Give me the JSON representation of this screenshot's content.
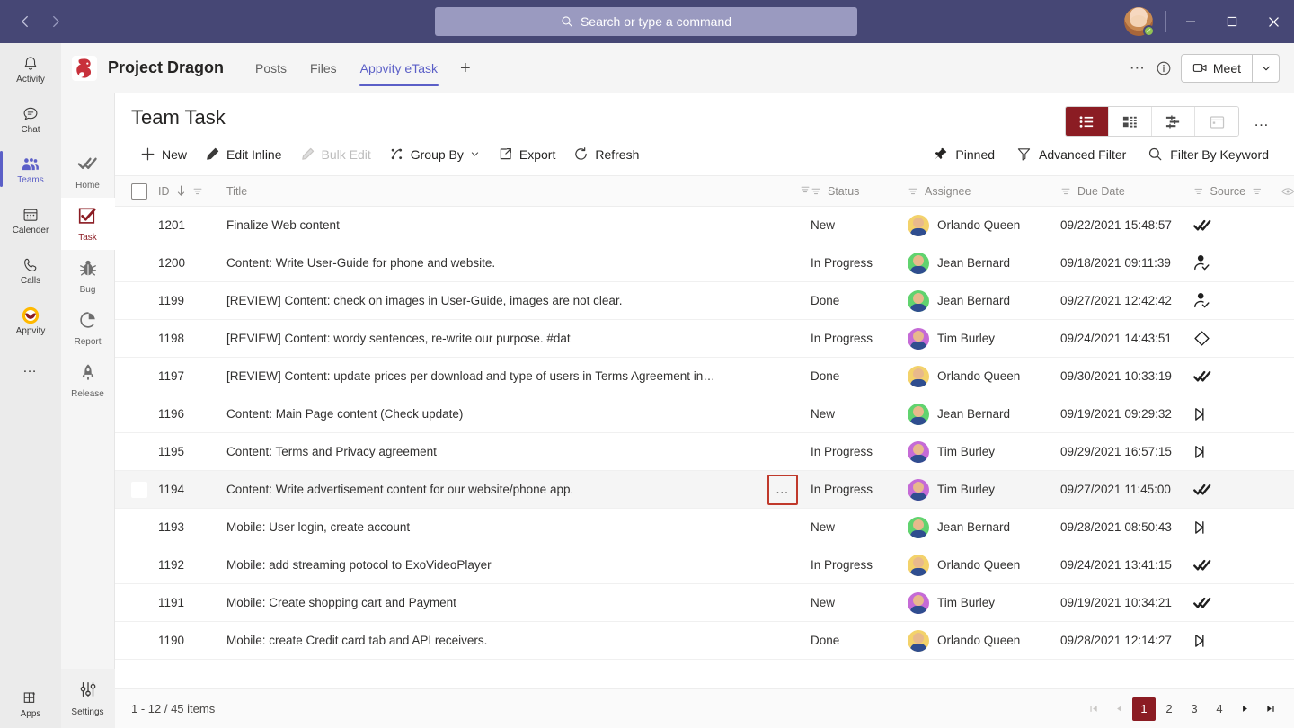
{
  "titlebar": {
    "back_icon": "chevron-left-icon",
    "forward_icon": "chevron-right-icon",
    "search_placeholder": "Search or type a command",
    "search_icon": "search-icon",
    "presence_status": "available",
    "minimize_label": "–",
    "maximize_label": "❐",
    "close_label": "✕"
  },
  "rail": {
    "items": [
      {
        "label": "Activity",
        "icon": "bell-icon",
        "active": false
      },
      {
        "label": "Chat",
        "icon": "chat-icon",
        "active": false
      },
      {
        "label": "Teams",
        "icon": "teams-icon",
        "active": true
      },
      {
        "label": "Calender",
        "icon": "calendar-icon",
        "active": false
      },
      {
        "label": "Calls",
        "icon": "phone-icon",
        "active": false
      },
      {
        "label": "Appvity",
        "icon": "appvity-icon",
        "active": false
      }
    ],
    "more_label": "…",
    "apps_label": "Apps",
    "apps_icon": "apps-icon"
  },
  "appnav": {
    "items": [
      {
        "label": "Home",
        "icon": "double-check-icon",
        "active": false
      },
      {
        "label": "Task",
        "icon": "task-check-icon",
        "active": true
      },
      {
        "label": "Bug",
        "icon": "bug-icon",
        "active": false
      },
      {
        "label": "Report",
        "icon": "pie-chart-icon",
        "active": false
      },
      {
        "label": "Release",
        "icon": "rocket-icon",
        "active": false
      }
    ],
    "settings_label": "Settings",
    "settings_icon": "sliders-icon"
  },
  "channel": {
    "team_name": "Project Dragon",
    "team_logo_icon": "dragon-logo-icon",
    "tabs": [
      {
        "label": "Posts",
        "active": false
      },
      {
        "label": "Files",
        "active": false
      },
      {
        "label": "Appvity eTask",
        "active": true
      }
    ],
    "add_tab_label": "+",
    "more_icon": "ellipsis-icon",
    "info_icon": "info-circle-icon",
    "meet_label": "Meet",
    "meet_icon": "camera-icon",
    "meet_caret_icon": "chevron-down-icon"
  },
  "page": {
    "title": "Team Task",
    "view_buttons": [
      {
        "icon": "list-view-icon",
        "active": true,
        "disabled": false
      },
      {
        "icon": "board-view-icon",
        "active": false,
        "disabled": false
      },
      {
        "icon": "gantt-view-icon",
        "active": false,
        "disabled": false
      },
      {
        "icon": "calendar-view-icon",
        "active": false,
        "disabled": true
      }
    ],
    "view_more_label": "…"
  },
  "toolbar": {
    "left": [
      {
        "label": "New",
        "icon": "plus-icon",
        "disabled": false
      },
      {
        "label": "Edit Inline",
        "icon": "pencil-icon",
        "disabled": false
      },
      {
        "label": "Bulk Edit",
        "icon": "pencil-icon",
        "disabled": true
      },
      {
        "label": "Group By",
        "icon": "group-by-icon",
        "disabled": false,
        "caret": true
      },
      {
        "label": "Export",
        "icon": "export-icon",
        "disabled": false
      },
      {
        "label": "Refresh",
        "icon": "refresh-icon",
        "disabled": false
      }
    ],
    "right": [
      {
        "label": "Pinned",
        "icon": "pin-icon"
      },
      {
        "label": "Advanced Filter",
        "icon": "funnel-icon"
      },
      {
        "label": "Filter By Keyword",
        "icon": "search-icon"
      }
    ]
  },
  "table": {
    "columns": [
      {
        "key": "checkbox",
        "label": ""
      },
      {
        "key": "id",
        "label": "ID",
        "sort_icon": "sort-down-icon",
        "filter_icon": "filter-icon"
      },
      {
        "key": "title",
        "label": "Title",
        "filter_icon": "filter-icon"
      },
      {
        "key": "status",
        "label": "Status",
        "filter_icon": "filter-icon"
      },
      {
        "key": "assignee",
        "label": "Assignee",
        "filter_icon": "filter-icon"
      },
      {
        "key": "due_date",
        "label": "Due Date",
        "filter_icon": "filter-icon"
      },
      {
        "key": "source",
        "label": "Source",
        "filter_icon": "filter-icon"
      },
      {
        "key": "visibility",
        "label": "",
        "icon": "eye-icon"
      }
    ],
    "rows": [
      {
        "id": "1201",
        "title": "Finalize Web content",
        "status": "New",
        "assignee": "Orlando Queen",
        "avatar_color": "#f3d26b",
        "due_date": "09/22/2021 15:48:57",
        "source_icon": "double-check-icon",
        "selected": false
      },
      {
        "id": "1200",
        "title": "Content: Write User-Guide for phone and website.",
        "status": "In Progress",
        "assignee": "Jean Bernard",
        "avatar_color": "#61d36f",
        "due_date": "09/18/2021 09:11:39",
        "source_icon": "person-check-icon",
        "selected": false
      },
      {
        "id": "1199",
        "title": "[REVIEW] Content: check on images in User-Guide, images are not clear.",
        "status": "Done",
        "assignee": "Jean Bernard",
        "avatar_color": "#61d36f",
        "due_date": "09/27/2021 12:42:42",
        "source_icon": "person-check-icon",
        "selected": false
      },
      {
        "id": "1198",
        "title": "[REVIEW] Content: wordy sentences, re-write our purpose. #dat",
        "status": "In Progress",
        "assignee": "Tim Burley",
        "avatar_color": "#c56bd6",
        "due_date": "09/24/2021 14:43:51",
        "source_icon": "diamond-icon",
        "selected": false
      },
      {
        "id": "1197",
        "title": "[REVIEW] Content: update prices per download and type of users in Terms Agreement in…",
        "status": "Done",
        "assignee": "Orlando Queen",
        "avatar_color": "#f3d26b",
        "due_date": "09/30/2021 10:33:19",
        "source_icon": "double-check-icon",
        "selected": false
      },
      {
        "id": "1196",
        "title": "Content: Main Page content (Check update)",
        "status": "New",
        "assignee": "Jean Bernard",
        "avatar_color": "#61d36f",
        "due_date": "09/19/2021 09:29:32",
        "source_icon": "flag-outline-icon",
        "selected": false
      },
      {
        "id": "1195",
        "title": "Content: Terms and Privacy agreement",
        "status": "In Progress",
        "assignee": "Tim Burley",
        "avatar_color": "#c56bd6",
        "due_date": "09/29/2021 16:57:15",
        "source_icon": "flag-outline-icon",
        "selected": false
      },
      {
        "id": "1194",
        "title": "Content: Write advertisement content for our website/phone app.",
        "status": "In Progress",
        "assignee": "Tim Burley",
        "avatar_color": "#c56bd6",
        "due_date": "09/27/2021 11:45:00",
        "source_icon": "double-check-icon",
        "selected": true
      },
      {
        "id": "1193",
        "title": "Mobile: User login, create account",
        "status": "New",
        "assignee": "Jean Bernard",
        "avatar_color": "#61d36f",
        "due_date": "09/28/2021 08:50:43",
        "source_icon": "flag-outline-icon",
        "selected": false
      },
      {
        "id": "1192",
        "title": "Mobile: add streaming potocol to ExoVideoPlayer",
        "status": "In Progress",
        "assignee": "Orlando Queen",
        "avatar_color": "#f3d26b",
        "due_date": "09/24/2021 13:41:15",
        "source_icon": "double-check-icon",
        "selected": false
      },
      {
        "id": "1191",
        "title": "Mobile: Create shopping cart and Payment",
        "status": "New",
        "assignee": "Tim Burley",
        "avatar_color": "#c56bd6",
        "due_date": "09/19/2021 10:34:21",
        "source_icon": "double-check-icon",
        "selected": false
      },
      {
        "id": "1190",
        "title": "Mobile: create Credit card tab and API receivers.",
        "status": "Done",
        "assignee": "Orlando Queen",
        "avatar_color": "#f3d26b",
        "due_date": "09/28/2021 12:14:27",
        "source_icon": "flag-outline-icon",
        "selected": false
      }
    ],
    "row_more_label": "…"
  },
  "footer": {
    "items_count": "1 - 12 / 45 items",
    "pager": {
      "first_label": "⧏|",
      "prev_label": "◀",
      "pages": [
        "1",
        "2",
        "3",
        "4"
      ],
      "current_page": "1",
      "next_label": "▶",
      "last_label": "▶|"
    }
  },
  "colors": {
    "teams_purple": "#464775",
    "accent_red": "#8b1c23",
    "highlight_red": "#c0392b",
    "link_purple": "#5b5fc7"
  }
}
